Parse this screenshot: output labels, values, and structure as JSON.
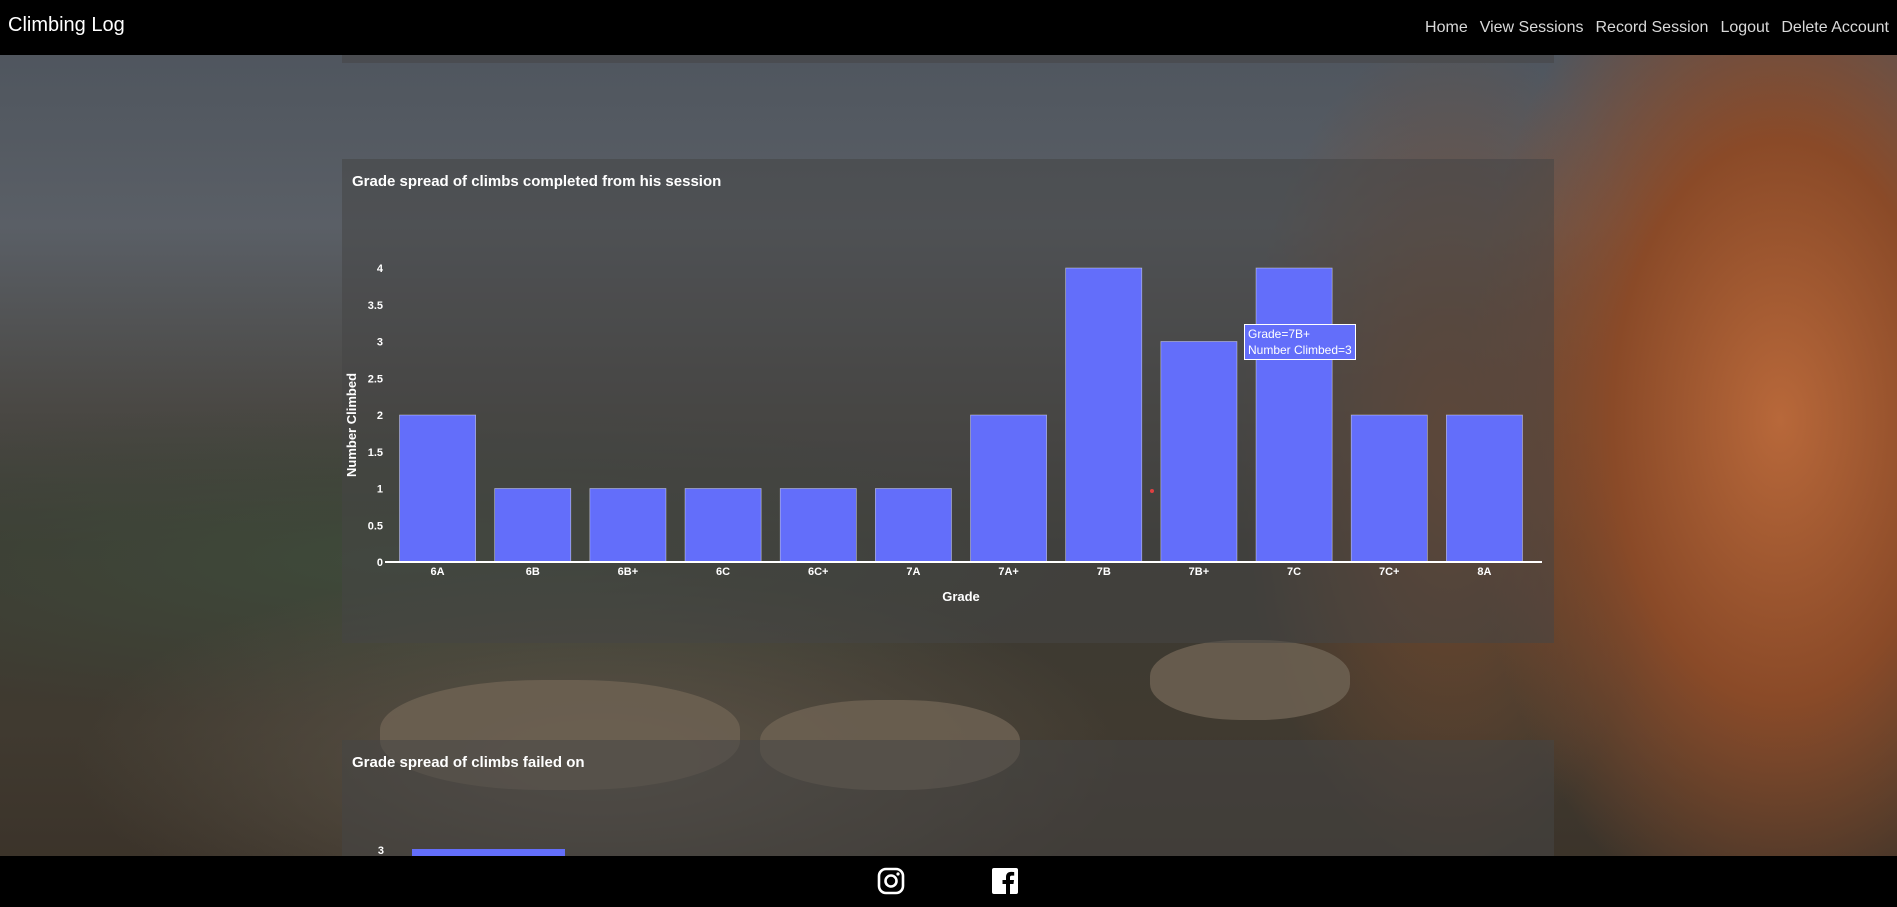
{
  "app": {
    "brand": "Climbing Log"
  },
  "nav": {
    "items": [
      {
        "label": "Home"
      },
      {
        "label": "View Sessions"
      },
      {
        "label": "Record Session"
      },
      {
        "label": "Logout"
      },
      {
        "label": "Delete Account"
      }
    ]
  },
  "completed_chart": {
    "title": "Grade spread of climbs completed from his session",
    "tooltip": {
      "line1": "Grade=7B+",
      "line2": "Number Climbed=3"
    }
  },
  "failed_chart": {
    "title": "Grade spread of climbs failed on"
  },
  "chart_data": [
    {
      "type": "bar",
      "title": "Grade spread of climbs completed from his session",
      "xlabel": "Grade",
      "ylabel": "Number Climbed",
      "categories": [
        "6A",
        "6B",
        "6B+",
        "6C",
        "6C+",
        "7A",
        "7A+",
        "7B",
        "7B+",
        "7C",
        "7C+",
        "8A"
      ],
      "values": [
        2,
        1,
        1,
        1,
        1,
        1,
        2,
        4,
        3,
        4,
        2,
        2
      ],
      "ylim": [
        0,
        4
      ],
      "yticks": [
        "0",
        "0.5",
        "1",
        "1.5",
        "2",
        "2.5",
        "3",
        "3.5",
        "4"
      ],
      "color": "#636efa",
      "grid": false
    },
    {
      "type": "bar",
      "title": "Grade spread of climbs failed on",
      "visible_ytick": "3",
      "first_bar_value": 3,
      "color": "#636efa"
    }
  ],
  "footer": {
    "icons": [
      "instagram-icon",
      "facebook-icon"
    ]
  },
  "colors": {
    "bar": "#636efa",
    "navbar": "#000000"
  }
}
